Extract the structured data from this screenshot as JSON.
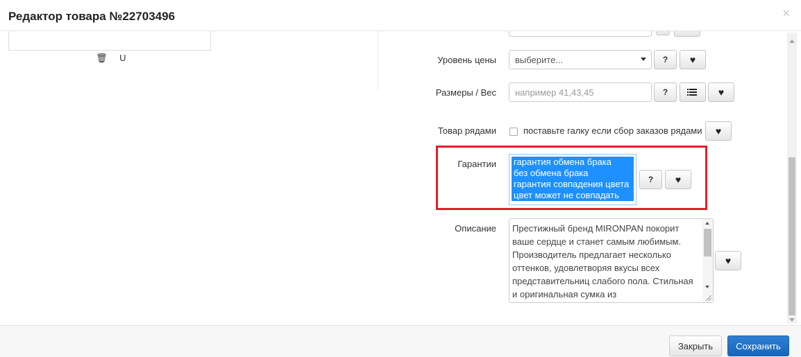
{
  "modal": {
    "title": "Редактор товара №22703496",
    "close_symbol": "×"
  },
  "image_tools": {
    "delete_symbol": "🗑",
    "magnet_symbol": "U"
  },
  "fields": {
    "price_level": {
      "label": "Уровень цены",
      "value": "выберите...",
      "help_label": "?"
    },
    "sizes": {
      "label": "Размеры / Вес",
      "placeholder": "например 41,43,45",
      "help_label": "?"
    },
    "rows": {
      "label": "Товар рядами",
      "checkbox_text": "поставьте галку если сбор заказов рядами"
    },
    "guarantees": {
      "label": "Гарантии",
      "options": [
        "гарантия обмена брака",
        "без обмена брака",
        "гарантия совпадения цвета",
        "цвет может не совпадать"
      ],
      "help_label": "?"
    },
    "description": {
      "label": "Описание",
      "lines": [
        "Престижный бренд MIRONPAN покорит",
        "ваше сердце и станет самым любимым.",
        "Производитель предлагает несколько",
        "оттенков, удовлетворяя вкусы всех",
        "представительниц слабого пола. Стильная",
        "и оригинальная сумка из"
      ]
    }
  },
  "icons": {
    "heart": "♥"
  },
  "footer": {
    "close_label": "Закрыть",
    "save_label": "Сохранить"
  },
  "colors": {
    "highlight_frame": "#e0202a",
    "selection": "#1e90ff",
    "primary_button": "#1766bf"
  }
}
